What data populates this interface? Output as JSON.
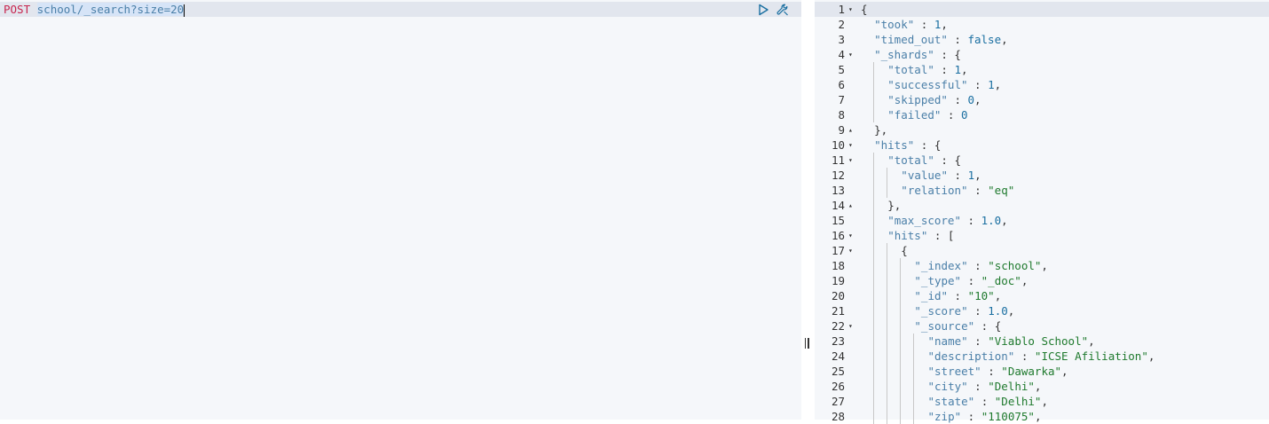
{
  "request": {
    "method": "POST",
    "url": "school/_search?size=20"
  },
  "icons": {
    "play": "play-icon",
    "settings": "wrench-icon"
  },
  "response": {
    "lines": [
      {
        "n": "1",
        "fold": "▾",
        "indent": 0,
        "tokens": [
          {
            "t": "{",
            "c": "p"
          }
        ]
      },
      {
        "n": "2",
        "fold": "",
        "indent": 1,
        "tokens": [
          {
            "t": "\"took\"",
            "c": "k"
          },
          {
            "t": " : ",
            "c": "p"
          },
          {
            "t": "1",
            "c": "n"
          },
          {
            "t": ",",
            "c": "p"
          }
        ]
      },
      {
        "n": "3",
        "fold": "",
        "indent": 1,
        "tokens": [
          {
            "t": "\"timed_out\"",
            "c": "k"
          },
          {
            "t": " : ",
            "c": "p"
          },
          {
            "t": "false",
            "c": "b"
          },
          {
            "t": ",",
            "c": "p"
          }
        ]
      },
      {
        "n": "4",
        "fold": "▾",
        "indent": 1,
        "tokens": [
          {
            "t": "\"_shards\"",
            "c": "k"
          },
          {
            "t": " : {",
            "c": "p"
          }
        ]
      },
      {
        "n": "5",
        "fold": "",
        "indent": 2,
        "tokens": [
          {
            "t": "\"total\"",
            "c": "k"
          },
          {
            "t": " : ",
            "c": "p"
          },
          {
            "t": "1",
            "c": "n"
          },
          {
            "t": ",",
            "c": "p"
          }
        ]
      },
      {
        "n": "6",
        "fold": "",
        "indent": 2,
        "tokens": [
          {
            "t": "\"successful\"",
            "c": "k"
          },
          {
            "t": " : ",
            "c": "p"
          },
          {
            "t": "1",
            "c": "n"
          },
          {
            "t": ",",
            "c": "p"
          }
        ]
      },
      {
        "n": "7",
        "fold": "",
        "indent": 2,
        "tokens": [
          {
            "t": "\"skipped\"",
            "c": "k"
          },
          {
            "t": " : ",
            "c": "p"
          },
          {
            "t": "0",
            "c": "n"
          },
          {
            "t": ",",
            "c": "p"
          }
        ]
      },
      {
        "n": "8",
        "fold": "",
        "indent": 2,
        "tokens": [
          {
            "t": "\"failed\"",
            "c": "k"
          },
          {
            "t": " : ",
            "c": "p"
          },
          {
            "t": "0",
            "c": "n"
          }
        ]
      },
      {
        "n": "9",
        "fold": "▴",
        "indent": 1,
        "tokens": [
          {
            "t": "},",
            "c": "p"
          }
        ]
      },
      {
        "n": "10",
        "fold": "▾",
        "indent": 1,
        "tokens": [
          {
            "t": "\"hits\"",
            "c": "k"
          },
          {
            "t": " : {",
            "c": "p"
          }
        ]
      },
      {
        "n": "11",
        "fold": "▾",
        "indent": 2,
        "tokens": [
          {
            "t": "\"total\"",
            "c": "k"
          },
          {
            "t": " : {",
            "c": "p"
          }
        ]
      },
      {
        "n": "12",
        "fold": "",
        "indent": 3,
        "tokens": [
          {
            "t": "\"value\"",
            "c": "k"
          },
          {
            "t": " : ",
            "c": "p"
          },
          {
            "t": "1",
            "c": "n"
          },
          {
            "t": ",",
            "c": "p"
          }
        ]
      },
      {
        "n": "13",
        "fold": "",
        "indent": 3,
        "tokens": [
          {
            "t": "\"relation\"",
            "c": "k"
          },
          {
            "t": " : ",
            "c": "p"
          },
          {
            "t": "\"eq\"",
            "c": "s"
          }
        ]
      },
      {
        "n": "14",
        "fold": "▴",
        "indent": 2,
        "tokens": [
          {
            "t": "},",
            "c": "p"
          }
        ]
      },
      {
        "n": "15",
        "fold": "",
        "indent": 2,
        "tokens": [
          {
            "t": "\"max_score\"",
            "c": "k"
          },
          {
            "t": " : ",
            "c": "p"
          },
          {
            "t": "1.0",
            "c": "n"
          },
          {
            "t": ",",
            "c": "p"
          }
        ]
      },
      {
        "n": "16",
        "fold": "▾",
        "indent": 2,
        "tokens": [
          {
            "t": "\"hits\"",
            "c": "k"
          },
          {
            "t": " : [",
            "c": "p"
          }
        ]
      },
      {
        "n": "17",
        "fold": "▾",
        "indent": 3,
        "tokens": [
          {
            "t": "{",
            "c": "p"
          }
        ]
      },
      {
        "n": "18",
        "fold": "",
        "indent": 4,
        "tokens": [
          {
            "t": "\"_index\"",
            "c": "k"
          },
          {
            "t": " : ",
            "c": "p"
          },
          {
            "t": "\"school\"",
            "c": "s"
          },
          {
            "t": ",",
            "c": "p"
          }
        ]
      },
      {
        "n": "19",
        "fold": "",
        "indent": 4,
        "tokens": [
          {
            "t": "\"_type\"",
            "c": "k"
          },
          {
            "t": " : ",
            "c": "p"
          },
          {
            "t": "\"_doc\"",
            "c": "s"
          },
          {
            "t": ",",
            "c": "p"
          }
        ]
      },
      {
        "n": "20",
        "fold": "",
        "indent": 4,
        "tokens": [
          {
            "t": "\"_id\"",
            "c": "k"
          },
          {
            "t": " : ",
            "c": "p"
          },
          {
            "t": "\"10\"",
            "c": "s"
          },
          {
            "t": ",",
            "c": "p"
          }
        ]
      },
      {
        "n": "21",
        "fold": "",
        "indent": 4,
        "tokens": [
          {
            "t": "\"_score\"",
            "c": "k"
          },
          {
            "t": " : ",
            "c": "p"
          },
          {
            "t": "1.0",
            "c": "n"
          },
          {
            "t": ",",
            "c": "p"
          }
        ]
      },
      {
        "n": "22",
        "fold": "▾",
        "indent": 4,
        "tokens": [
          {
            "t": "\"_source\"",
            "c": "k"
          },
          {
            "t": " : {",
            "c": "p"
          }
        ]
      },
      {
        "n": "23",
        "fold": "",
        "indent": 5,
        "tokens": [
          {
            "t": "\"name\"",
            "c": "k"
          },
          {
            "t": " : ",
            "c": "p"
          },
          {
            "t": "\"Viablo School\"",
            "c": "s"
          },
          {
            "t": ",",
            "c": "p"
          }
        ]
      },
      {
        "n": "24",
        "fold": "",
        "indent": 5,
        "tokens": [
          {
            "t": "\"description\"",
            "c": "k"
          },
          {
            "t": " : ",
            "c": "p"
          },
          {
            "t": "\"ICSE Afiliation\"",
            "c": "s"
          },
          {
            "t": ",",
            "c": "p"
          }
        ]
      },
      {
        "n": "25",
        "fold": "",
        "indent": 5,
        "tokens": [
          {
            "t": "\"street\"",
            "c": "k"
          },
          {
            "t": " : ",
            "c": "p"
          },
          {
            "t": "\"Dawarka\"",
            "c": "s"
          },
          {
            "t": ",",
            "c": "p"
          }
        ]
      },
      {
        "n": "26",
        "fold": "",
        "indent": 5,
        "tokens": [
          {
            "t": "\"city\"",
            "c": "k"
          },
          {
            "t": " : ",
            "c": "p"
          },
          {
            "t": "\"Delhi\"",
            "c": "s"
          },
          {
            "t": ",",
            "c": "p"
          }
        ]
      },
      {
        "n": "27",
        "fold": "",
        "indent": 5,
        "tokens": [
          {
            "t": "\"state\"",
            "c": "k"
          },
          {
            "t": " : ",
            "c": "p"
          },
          {
            "t": "\"Delhi\"",
            "c": "s"
          },
          {
            "t": ",",
            "c": "p"
          }
        ]
      },
      {
        "n": "28",
        "fold": "",
        "indent": 5,
        "tokens": [
          {
            "t": "\"zip\"",
            "c": "k"
          },
          {
            "t": " : ",
            "c": "p"
          },
          {
            "t": "\"110075\"",
            "c": "s"
          },
          {
            "t": ",",
            "c": "p"
          }
        ]
      }
    ]
  },
  "colors": {
    "key": "#4a7fa8",
    "string": "#1f7a2e",
    "number": "#1a6fa1",
    "method": "#c7254e",
    "active_line": "#e2e6ee",
    "editor_bg": "#f5f7fa"
  }
}
